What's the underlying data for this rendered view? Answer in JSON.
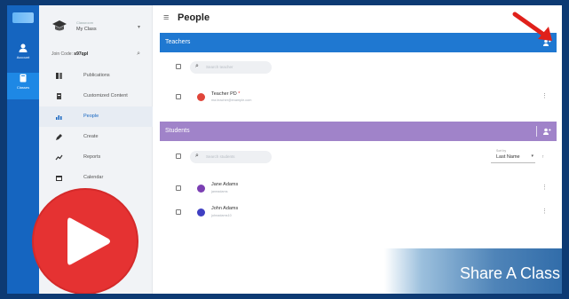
{
  "page": {
    "title": "People"
  },
  "rail": {
    "items": [
      {
        "label": "Account",
        "icon": "person-icon"
      },
      {
        "label": "Classes",
        "icon": "book-icon"
      }
    ]
  },
  "class_card": {
    "small_text": "Classroom",
    "name": "My Class"
  },
  "join_code": {
    "label": "Join Code:",
    "value": "s97qpl"
  },
  "menu": [
    {
      "label": "Publications",
      "icon": "publications-icon"
    },
    {
      "label": "Customized Content",
      "icon": "content-icon"
    },
    {
      "label": "People",
      "icon": "people-icon"
    },
    {
      "label": "Create",
      "icon": "create-icon"
    },
    {
      "label": "Reports",
      "icon": "reports-icon"
    },
    {
      "label": "Calendar",
      "icon": "calendar-icon"
    }
  ],
  "teachers": {
    "header": "Teachers",
    "search_placeholder": "Search teacher",
    "rows": [
      {
        "name": "Teacher PD",
        "badge": "*",
        "subtitle": "ma.teacher@example.com"
      }
    ]
  },
  "students": {
    "header": "Students",
    "search_placeholder": "Search students",
    "sort_label": "Sort by",
    "sort_value": "Last Name",
    "rows": [
      {
        "name": "Jane Adams",
        "subtitle": "janeadams"
      },
      {
        "name": "John Adams",
        "subtitle": "johnadams10"
      }
    ]
  },
  "banner": {
    "text": "Share A Class"
  },
  "colors": {
    "teachers_header": "#1f78d1",
    "students_header": "#a083c9",
    "rail": "#1565c0",
    "play": "#e53232"
  }
}
